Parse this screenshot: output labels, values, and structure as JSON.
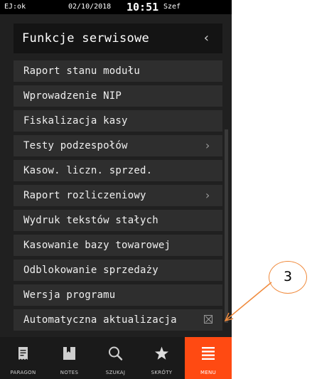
{
  "statusbar": {
    "left": "EJ:ok",
    "date": "02/10/2018",
    "time": "10:51",
    "user": "Szef"
  },
  "header": {
    "title": "Funkcje serwisowe",
    "back_icon": "chevron-left-icon"
  },
  "menu": {
    "items": [
      {
        "label": "Raport stanu modułu"
      },
      {
        "label": "Wprowadzenie NIP"
      },
      {
        "label": "Fiskalizacja kasy"
      },
      {
        "label": "Testy podzespołów",
        "submenu": true
      },
      {
        "label": "Kasow. liczn. sprzed."
      },
      {
        "label": "Raport rozliczeniowy",
        "submenu": true
      },
      {
        "label": "Wydruk tekstów stałych"
      },
      {
        "label": "Kasowanie bazy towarowej"
      },
      {
        "label": "Odblokowanie sprzedaży"
      },
      {
        "label": "Wersja programu"
      },
      {
        "label": "Automatyczna aktualizacja",
        "checkbox": "unchecked"
      }
    ]
  },
  "tabbar": {
    "tabs": [
      {
        "label": "PARAGON",
        "icon": "receipt-icon"
      },
      {
        "label": "NOTES",
        "icon": "notebook-icon"
      },
      {
        "label": "SZUKAJ",
        "icon": "search-icon"
      },
      {
        "label": "SKRÓTY",
        "icon": "star-icon"
      },
      {
        "label": "MENU",
        "icon": "menu-icon",
        "active": true
      }
    ]
  },
  "annotation": {
    "number": "3"
  },
  "colors": {
    "accent": "#ff4a12",
    "callout": "#f08a3c",
    "background": "#202020"
  }
}
